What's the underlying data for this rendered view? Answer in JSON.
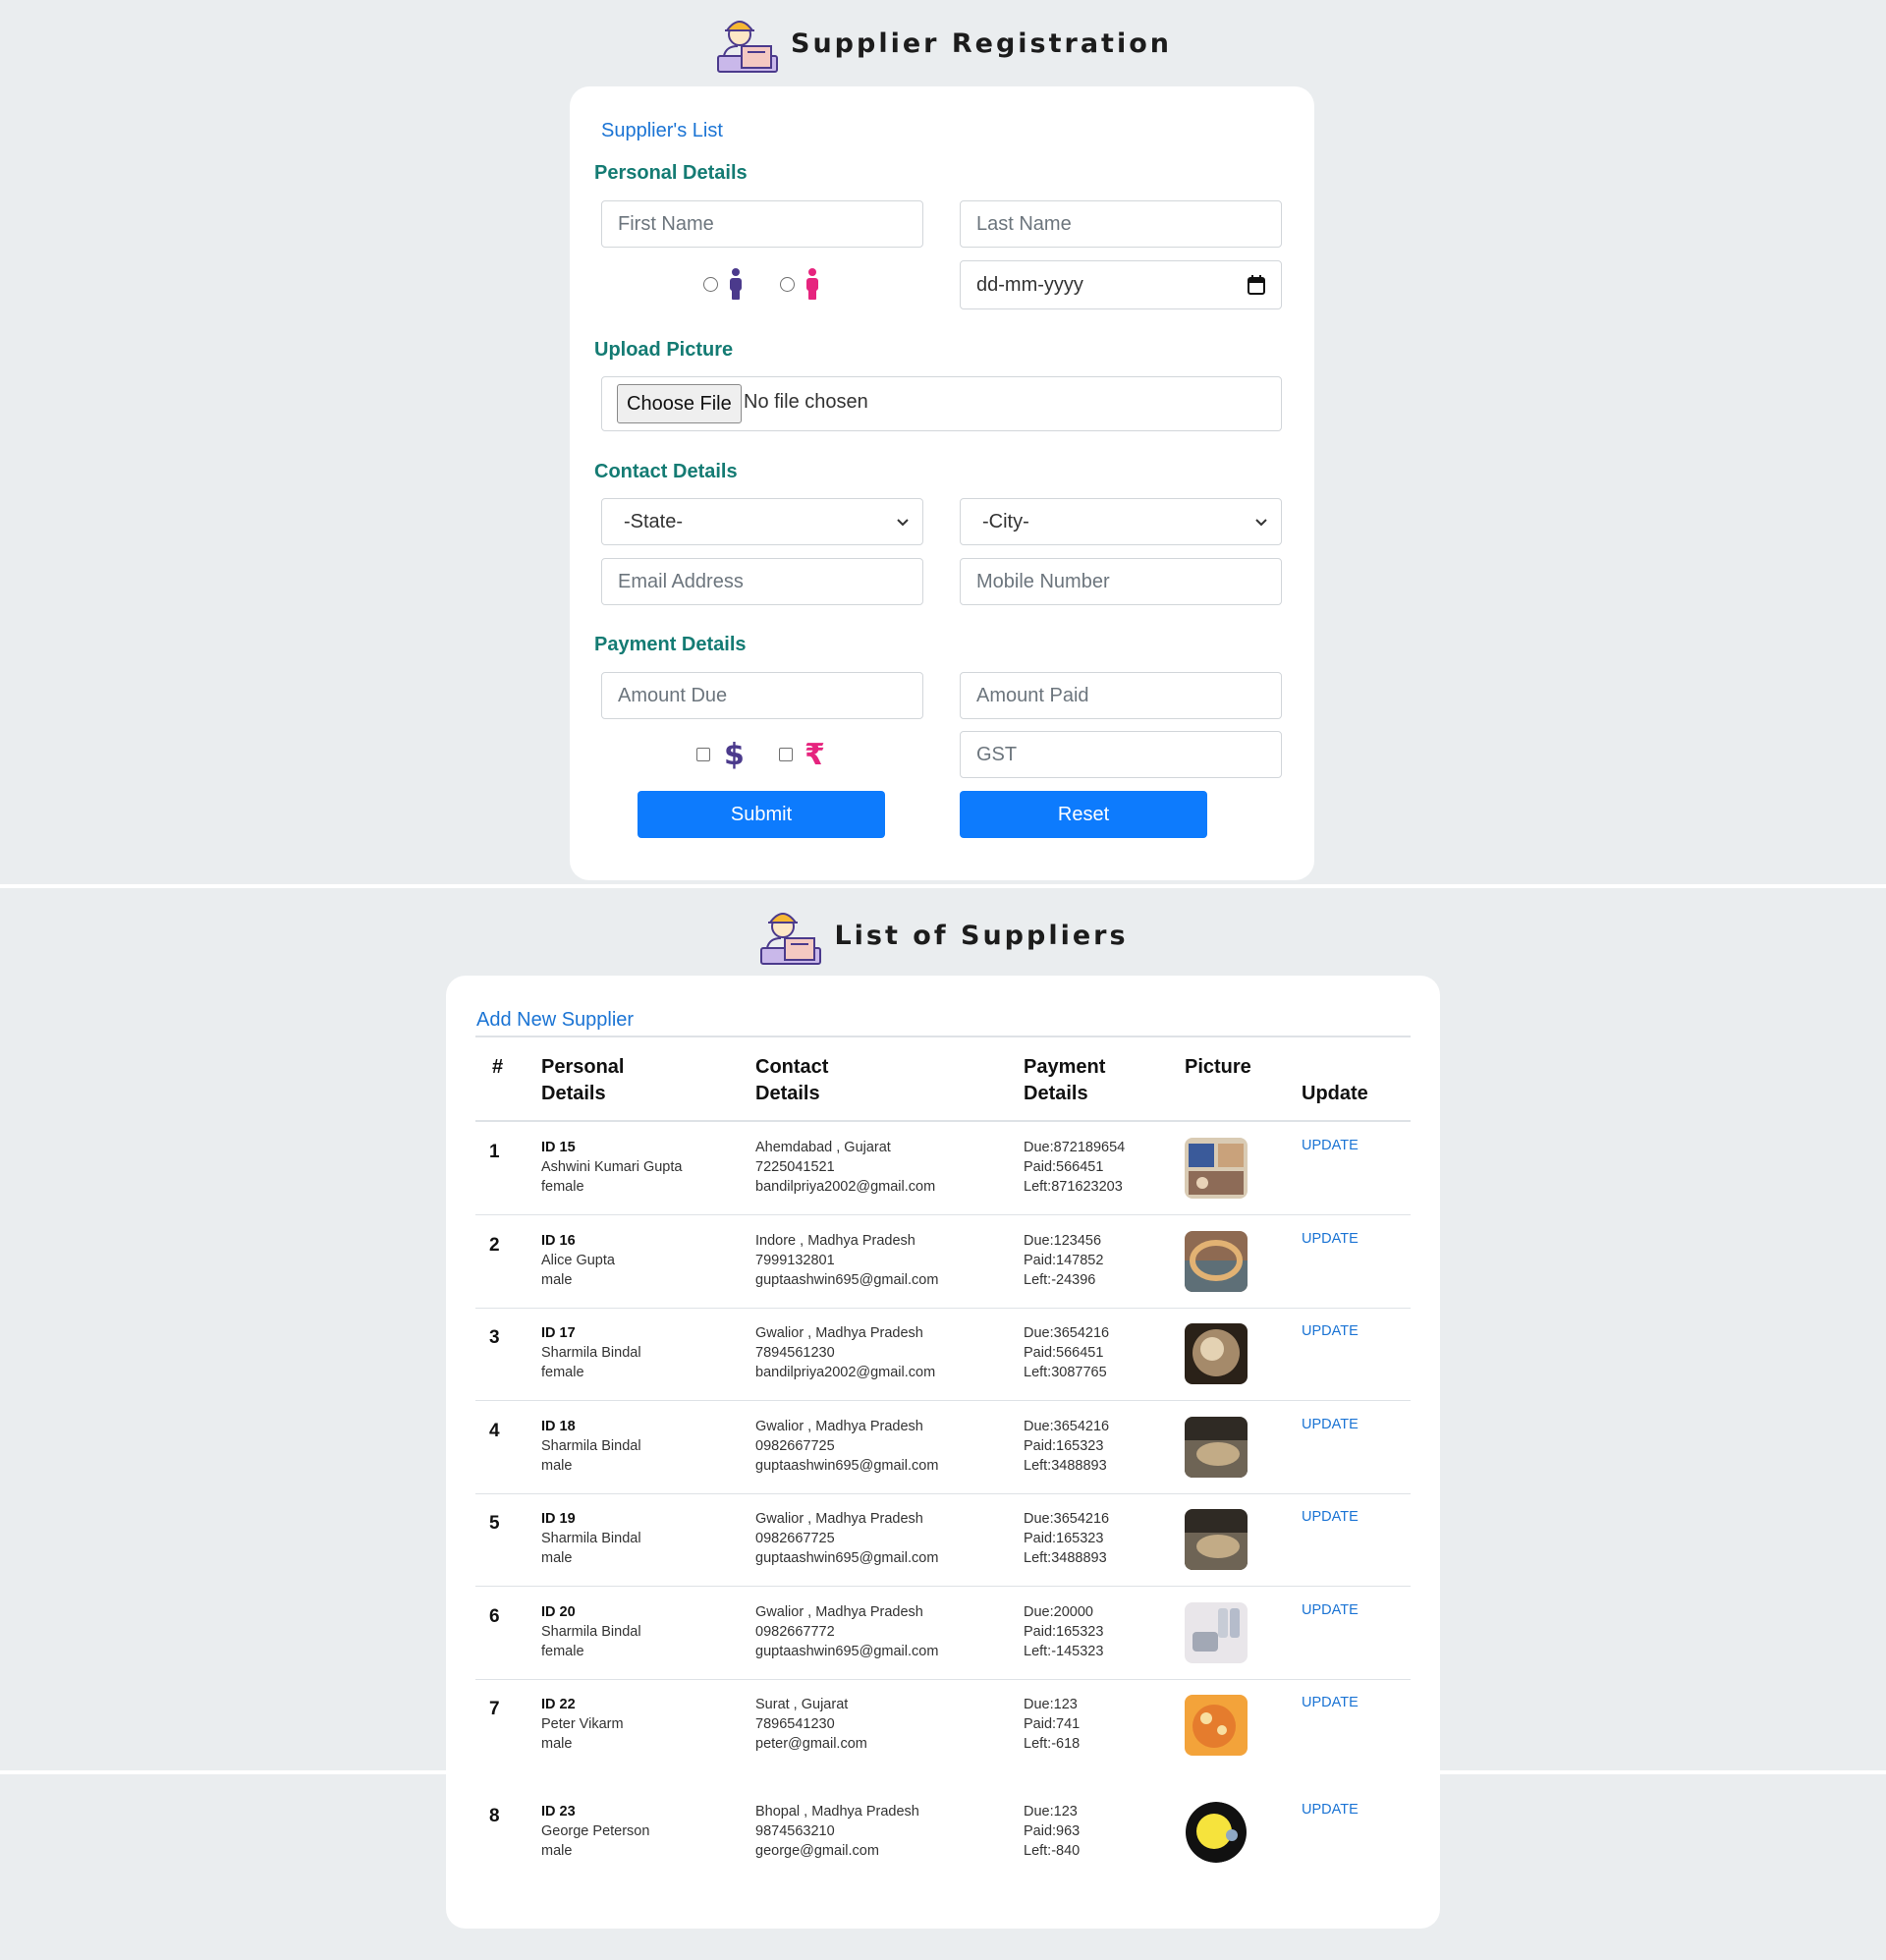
{
  "registration": {
    "title": "Supplier Registration",
    "suppliers_list_link": "Supplier's List",
    "personal_section": "Personal Details",
    "first_name_placeholder": "First Name",
    "last_name_placeholder": "Last Name",
    "dob_placeholder": "dd-mm-yyyy",
    "upload_section": "Upload Picture",
    "choose_file_label": "Choose File",
    "no_file_text": "No file chosen",
    "contact_section": "Contact Details",
    "state_selected": "-State-",
    "city_selected": "-City-",
    "email_placeholder": "Email Address",
    "mobile_placeholder": "Mobile Number",
    "payment_section": "Payment Details",
    "amount_due_placeholder": "Amount Due",
    "amount_paid_placeholder": "Amount Paid",
    "gst_placeholder": "GST",
    "submit_label": "Submit",
    "reset_label": "Reset"
  },
  "list": {
    "title": "List of Suppliers",
    "add_link": "Add New Supplier",
    "headers": {
      "num": "#",
      "personal_1": "Personal",
      "personal_2": "Details",
      "contact_1": "Contact",
      "contact_2": "Details",
      "payment_1": "Payment",
      "payment_2": "Details",
      "picture": "Picture",
      "update": "Update"
    },
    "rows": [
      {
        "n": "1",
        "id": "ID 15",
        "name": "Ashwini Kumari Gupta",
        "gender": "female",
        "location": "Ahemdabad , Gujarat",
        "phone": "7225041521",
        "email": "bandilpriya2002@gmail.com",
        "due": "Due:872189654",
        "paid": "Paid:566451",
        "left": "Left:871623203",
        "update": "UPDATE"
      },
      {
        "n": "2",
        "id": "ID 16",
        "name": "Alice Gupta",
        "gender": "male",
        "location": "Indore , Madhya Pradesh",
        "phone": "7999132801",
        "email": "guptaashwin695@gmail.com",
        "due": "Due:123456",
        "paid": "Paid:147852",
        "left": "Left:-24396",
        "update": "UPDATE"
      },
      {
        "n": "3",
        "id": "ID 17",
        "name": "Sharmila Bindal",
        "gender": "female",
        "location": "Gwalior , Madhya Pradesh",
        "phone": "7894561230",
        "email": "bandilpriya2002@gmail.com",
        "due": "Due:3654216",
        "paid": "Paid:566451",
        "left": "Left:3087765",
        "update": "UPDATE"
      },
      {
        "n": "4",
        "id": "ID 18",
        "name": "Sharmila Bindal",
        "gender": "male",
        "location": "Gwalior , Madhya Pradesh",
        "phone": "0982667725",
        "email": "guptaashwin695@gmail.com",
        "due": "Due:3654216",
        "paid": "Paid:165323",
        "left": "Left:3488893",
        "update": "UPDATE"
      },
      {
        "n": "5",
        "id": "ID 19",
        "name": "Sharmila Bindal",
        "gender": "male",
        "location": "Gwalior , Madhya Pradesh",
        "phone": "0982667725",
        "email": "guptaashwin695@gmail.com",
        "due": "Due:3654216",
        "paid": "Paid:165323",
        "left": "Left:3488893",
        "update": "UPDATE"
      },
      {
        "n": "6",
        "id": "ID 20",
        "name": "Sharmila Bindal",
        "gender": "female",
        "location": "Gwalior , Madhya Pradesh",
        "phone": "0982667772",
        "email": "guptaashwin695@gmail.com",
        "due": "Due:20000",
        "paid": "Paid:165323",
        "left": "Left:-145323",
        "update": "UPDATE"
      },
      {
        "n": "7",
        "id": "ID 22",
        "name": "Peter Vikarm",
        "gender": "male",
        "location": "Surat , Gujarat",
        "phone": "7896541230",
        "email": "peter@gmail.com",
        "due": "Due:123",
        "paid": "Paid:741",
        "left": "Left:-618",
        "update": "UPDATE"
      },
      {
        "n": "8",
        "id": "ID 23",
        "name": "George Peterson",
        "gender": "male",
        "location": "Bhopal , Madhya Pradesh",
        "phone": "9874563210",
        "email": "george@gmail.com",
        "due": "Due:123",
        "paid": "Paid:963",
        "left": "Left:-840",
        "update": "UPDATE"
      }
    ]
  },
  "icons": {
    "logo": "supplier-worker-icon",
    "male": "male-person-icon",
    "female": "female-person-icon",
    "dollar": "dollar-icon",
    "rupee": "rupee-icon",
    "calendar": "calendar-icon",
    "select_arrow": "chevron-down-icon"
  },
  "colors": {
    "accent_blue": "#0d7bfd",
    "section_teal": "#147b73",
    "link_blue": "#1b74d4",
    "male_purple": "#4b3a8c",
    "female_pink": "#e6247e"
  }
}
